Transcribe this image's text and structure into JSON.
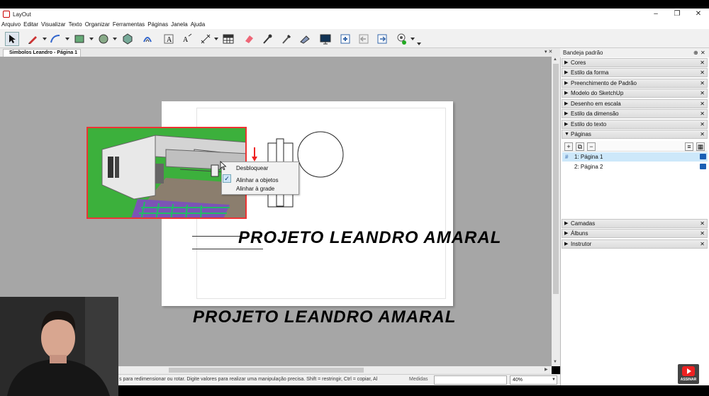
{
  "app": {
    "title": "LayOut",
    "minimize": "–",
    "maximize": "❐",
    "close": "✕"
  },
  "menu": [
    "Arquivo",
    "Editar",
    "Visualizar",
    "Texto",
    "Organizar",
    "Ferramentas",
    "Páginas",
    "Janela",
    "Ajuda"
  ],
  "toolbar": {
    "tools": [
      "select-tool-icon",
      "pencil-icon",
      "arc-icon",
      "rectangle-icon",
      "circle-icon",
      "polygon-icon",
      "offset-icon",
      "text-icon",
      "label-icon",
      "dimension-icon",
      "table-icon",
      "eraser-icon",
      "eyedropper-icon",
      "style-icon",
      "split-icon",
      "presentation-icon",
      "add-page-icon",
      "previous-page-icon",
      "next-page-icon",
      "instructor-icon"
    ]
  },
  "document": {
    "tab_label": "Simbolos Leandro - Página 1"
  },
  "context_menu": {
    "items": [
      "Desbloquear",
      "Alinhar a objetos",
      "Alinhar à grade"
    ],
    "checked": "Alinhar a objetos"
  },
  "canvas": {
    "title_on_paper": "PROJETO LEANDRO AMARAL",
    "title_below": "PROJETO LEANDRO AMARAL"
  },
  "status": {
    "hint": "s para redimensionar ou rotar. Digite valores para realizar uma manipulação precisa. Shift = restringir, Ctrl = copiar, Al",
    "measurements_label": "Medidas",
    "measurements_value": "",
    "zoom": "40%"
  },
  "panel": {
    "title": "Bandeja padrão",
    "pin": "ᵖ",
    "sections_top": [
      "Cores",
      "Estilo da forma",
      "Preenchimento de Padrão",
      "Modelo do SketchUp",
      "Desenho em escala",
      "Estilo da dimensão",
      "Estilo do texto"
    ],
    "pages_section": "Páginas",
    "pages": [
      {
        "label": "1: Página 1",
        "selected": true
      },
      {
        "label": "2: Página 2",
        "selected": false
      }
    ],
    "page_marker": "#",
    "sections_bottom": [
      "Camadas",
      "Álbuns",
      "Instrutor"
    ]
  },
  "overlay": {
    "subscribe_label": "ASSINAR"
  },
  "colors": {
    "selection": "#e33333",
    "accent": "#cce4f7",
    "page_selected": "#cde8fa",
    "subscribe": "#e22222"
  }
}
